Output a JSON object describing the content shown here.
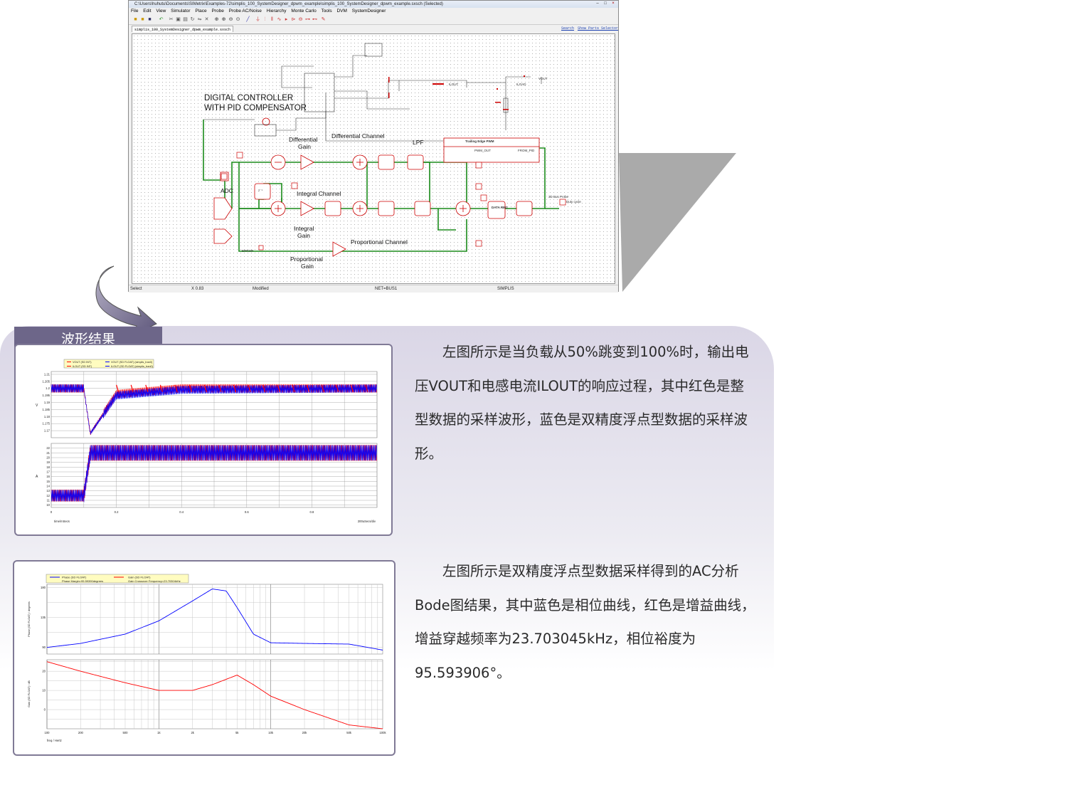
{
  "window": {
    "title": "C:\\Users\\huhutu\\Documents\\SIMetrix\\Examples-72\\simplis_100_SystemDesigner_dpwm_example\\simplis_100_SystemDesigner_dpwm_example.sxsch (Selected)",
    "menu": [
      "File",
      "Edit",
      "View",
      "Simulator",
      "Place",
      "Probe",
      "Probe AC/Noise",
      "Hierarchy",
      "Monte Carlo",
      "Tools",
      "DVM",
      "SystemDesigner"
    ],
    "tab": "simplis_100_SystemDesigner_dpwm_example.sxsch",
    "links": [
      "Search",
      "Show Parts Selector"
    ],
    "status": {
      "mode": "Select",
      "x": "X  0.83",
      "modified": "Modified",
      "net": "NET=BUS1",
      "sim": "SIMPLIS"
    }
  },
  "schematic": {
    "heading1": "DIGITAL CONTROLLER",
    "heading2": "WITH  PID COMPENSATOR",
    "labels": {
      "differential_gain_1": "Differential",
      "differential_gain_2": "Gain",
      "differential_channel": "Differential Channel",
      "lpf": "LPF",
      "adc": "ADC",
      "integral_channel": "Integral Channel",
      "integral_gain_1": "Integral",
      "integral_gain_2": "Gain",
      "proportional_channel": "Proportional Channel",
      "proportional_gain_1": "Proportional",
      "proportional_gain_2": "Gain",
      "pwm_title": "Trailing Edge PWM",
      "pwm_out": "PWM_OUT",
      "from_pid": "FROM_PID",
      "error": "ERROR",
      "vout": "VOUT",
      "iload": "ILOAD",
      "ilout": "ILOUT",
      "probe_duty": "3D Bus Probe",
      "duty_cycle": "Duty cycle",
      "data_reg": "DATA REG",
      "zinv": "z⁻¹"
    }
  },
  "section_title": "波形结果",
  "transient": {
    "legend": [
      "VOUT (SD INT)",
      "ILOUT (SD INT)",
      "VOUT (SD FLOAT) (simplis_tran0)",
      "ILOUT (SD FLOAT) (simplis_tran0)"
    ],
    "top_y_ticks": [
      "1.21",
      "1.205",
      "1.2",
      "1.195",
      "1.19",
      "1.185",
      "1.18",
      "1.175",
      "1.17"
    ],
    "top_unit": "V",
    "bottom_y_ticks": [
      "22",
      "21",
      "20",
      "19",
      "18",
      "17",
      "16",
      "15",
      "14",
      "13",
      "12",
      "11",
      "10"
    ],
    "bottom_unit": "A",
    "x_ticks": [
      "0",
      "0.2",
      "0.4",
      "0.6",
      "0.8"
    ],
    "x_label": "time/mSecs",
    "x_scale": "200uSecs/div"
  },
  "bode": {
    "legend_phase": "Phase (SD FLOAT)",
    "legend_gain": "Gain (SD FLOAT)",
    "phase_margin": "Phase Margin=95.59390degrees",
    "crossover": "Gain Crossover Frequency=23.70304kHz",
    "phase_axis_label": "Phase (SD FLOAT) / degrees",
    "phase_ticks": [
      "180",
      "135",
      "90"
    ],
    "gain_axis_label": "Gain (SD FLOAT) / dB",
    "gain_ticks": [
      "20",
      "10",
      "0"
    ],
    "x_ticks": [
      "100",
      "200",
      "500",
      "1k",
      "2k",
      "5k",
      "10k",
      "20k",
      "50k",
      "100k"
    ],
    "x_label": "freq / Hertz"
  },
  "chart_data": [
    {
      "type": "line",
      "title": "",
      "xlabel": "time/mSecs",
      "ylabel": "V",
      "xlim": [
        0,
        1.0
      ],
      "ylim": [
        1.165,
        1.212
      ],
      "series": [
        {
          "name": "VOUT (SD INT)",
          "x": [
            0,
            0.1,
            0.12,
            0.2,
            0.4,
            1.0
          ],
          "y": [
            1.2,
            1.2,
            1.168,
            1.196,
            1.2,
            1.2
          ]
        },
        {
          "name": "VOUT (SD FLOAT) (simplis_tran0)",
          "x": [
            0,
            0.1,
            0.12,
            0.2,
            0.4,
            1.0
          ],
          "y": [
            1.2,
            1.2,
            1.168,
            1.195,
            1.199,
            1.2
          ]
        }
      ]
    },
    {
      "type": "line",
      "title": "",
      "xlabel": "time/mSecs",
      "ylabel": "A",
      "xlim": [
        0,
        1.0
      ],
      "ylim": [
        9.5,
        23
      ],
      "series": [
        {
          "name": "ILOUT (SD INT)",
          "x": [
            0,
            0.1,
            0.12,
            1.0
          ],
          "y": [
            12,
            12,
            21,
            21
          ]
        },
        {
          "name": "ILOUT (SD FLOAT) (simplis_tran0)",
          "x": [
            0,
            0.1,
            0.12,
            1.0
          ],
          "y": [
            12,
            12,
            21,
            21
          ]
        }
      ]
    },
    {
      "type": "line",
      "title": "",
      "xlabel": "freq / Hertz",
      "ylabel": "Phase (SD FLOAT) / degrees",
      "log_x": true,
      "xlim": [
        100,
        100000
      ],
      "ylim": [
        80,
        185
      ],
      "series": [
        {
          "name": "Phase (SD FLOAT)",
          "x": [
            100,
            200,
            500,
            1000,
            2000,
            3000,
            4000,
            5000,
            7000,
            10000,
            20000,
            50000,
            100000
          ],
          "y": [
            90,
            96,
            110,
            130,
            160,
            178,
            175,
            150,
            110,
            97,
            96,
            95,
            86
          ]
        }
      ]
    },
    {
      "type": "line",
      "title": "",
      "xlabel": "freq / Hertz",
      "ylabel": "Gain (SD FLOAT) / dB",
      "log_x": true,
      "xlim": [
        100,
        100000
      ],
      "ylim": [
        -10,
        26
      ],
      "series": [
        {
          "name": "Gain (SD FLOAT)",
          "x": [
            100,
            200,
            500,
            1000,
            2000,
            3000,
            5000,
            7000,
            10000,
            20000,
            50000,
            100000
          ],
          "y": [
            25,
            20,
            14,
            10,
            10,
            13,
            18,
            13,
            7,
            0,
            -8,
            -10
          ]
        }
      ]
    }
  ],
  "desc1": "左图所示是当负载从50%跳变到100%时，输出电压VOUT和电感电流ILOUT的响应过程，其中红色是整型数据的采样波形，蓝色是双精度浮点型数据的采样波形。",
  "desc2": "左图所示是双精度浮点型数据采样得到的AC分析Bode图结果，其中蓝色是相位曲线，红色是增益曲线，增益穿越频率为23.703045kHz，相位裕度为95.593906°。",
  "colors": {
    "accent": "#6d6689",
    "int_series": "#ff0000",
    "float_series": "#0000ff",
    "wire": "#1a8a1a"
  }
}
